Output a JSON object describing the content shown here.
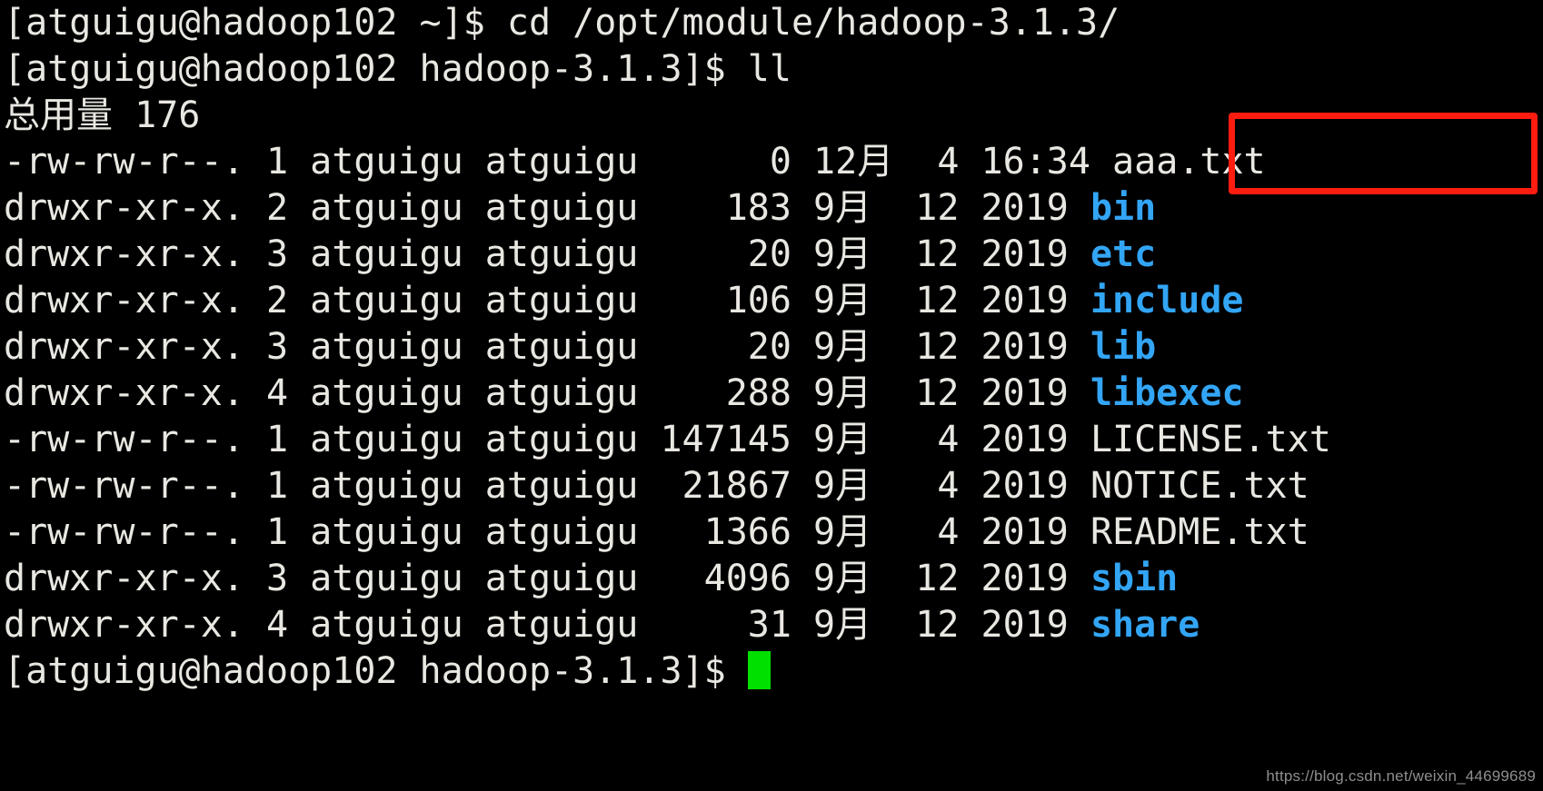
{
  "terminal": {
    "background_color": "#000000",
    "foreground_color": "#e9e7e1",
    "directory_color": "#33a5f5",
    "cursor_color": "#00e000",
    "annotation_color": "#fc1c10",
    "lines": [
      {
        "kind": "prompt",
        "text": "[atguigu@hadoop102 ~]$ cd /opt/module/hadoop-3.1.3/"
      },
      {
        "kind": "prompt",
        "text": "[atguigu@hadoop102 hadoop-3.1.3]$ ll"
      },
      {
        "kind": "output",
        "text": "总用量 176"
      },
      {
        "kind": "listing",
        "prefix": "-rw-rw-r--. 1 atguigu atguigu      0 12月  4 16:34 ",
        "name": "aaa.txt",
        "is_dir": false
      },
      {
        "kind": "listing",
        "prefix": "drwxr-xr-x. 2 atguigu atguigu    183 9月  12 2019 ",
        "name": "bin",
        "is_dir": true
      },
      {
        "kind": "listing",
        "prefix": "drwxr-xr-x. 3 atguigu atguigu     20 9月  12 2019 ",
        "name": "etc",
        "is_dir": true
      },
      {
        "kind": "listing",
        "prefix": "drwxr-xr-x. 2 atguigu atguigu    106 9月  12 2019 ",
        "name": "include",
        "is_dir": true
      },
      {
        "kind": "listing",
        "prefix": "drwxr-xr-x. 3 atguigu atguigu     20 9月  12 2019 ",
        "name": "lib",
        "is_dir": true
      },
      {
        "kind": "listing",
        "prefix": "drwxr-xr-x. 4 atguigu atguigu    288 9月  12 2019 ",
        "name": "libexec",
        "is_dir": true
      },
      {
        "kind": "listing",
        "prefix": "-rw-rw-r--. 1 atguigu atguigu 147145 9月   4 2019 ",
        "name": "LICENSE.txt",
        "is_dir": false
      },
      {
        "kind": "listing",
        "prefix": "-rw-rw-r--. 1 atguigu atguigu  21867 9月   4 2019 ",
        "name": "NOTICE.txt",
        "is_dir": false
      },
      {
        "kind": "listing",
        "prefix": "-rw-rw-r--. 1 atguigu atguigu   1366 9月   4 2019 ",
        "name": "README.txt",
        "is_dir": false
      },
      {
        "kind": "listing",
        "prefix": "drwxr-xr-x. 3 atguigu atguigu   4096 9月  12 2019 ",
        "name": "sbin",
        "is_dir": true
      },
      {
        "kind": "listing",
        "prefix": "drwxr-xr-x. 4 atguigu atguigu     31 9月  12 2019 ",
        "name": "share",
        "is_dir": true
      },
      {
        "kind": "prompt",
        "text": "[atguigu@hadoop102 hadoop-3.1.3]$ ",
        "cursor": true
      }
    ],
    "total_label": "总用量",
    "total_blocks": "176",
    "commands": [
      "cd /opt/module/hadoop-3.1.3/",
      "ll"
    ],
    "user": "atguigu",
    "host": "hadoop102",
    "cwd_home": "~",
    "cwd_dir": "hadoop-3.1.3"
  },
  "annotation": {
    "highlighted_filename": "aaa.txt",
    "color": "#fc1c10"
  },
  "watermark": {
    "text": "https://blog.csdn.net/weixin_44699689"
  }
}
